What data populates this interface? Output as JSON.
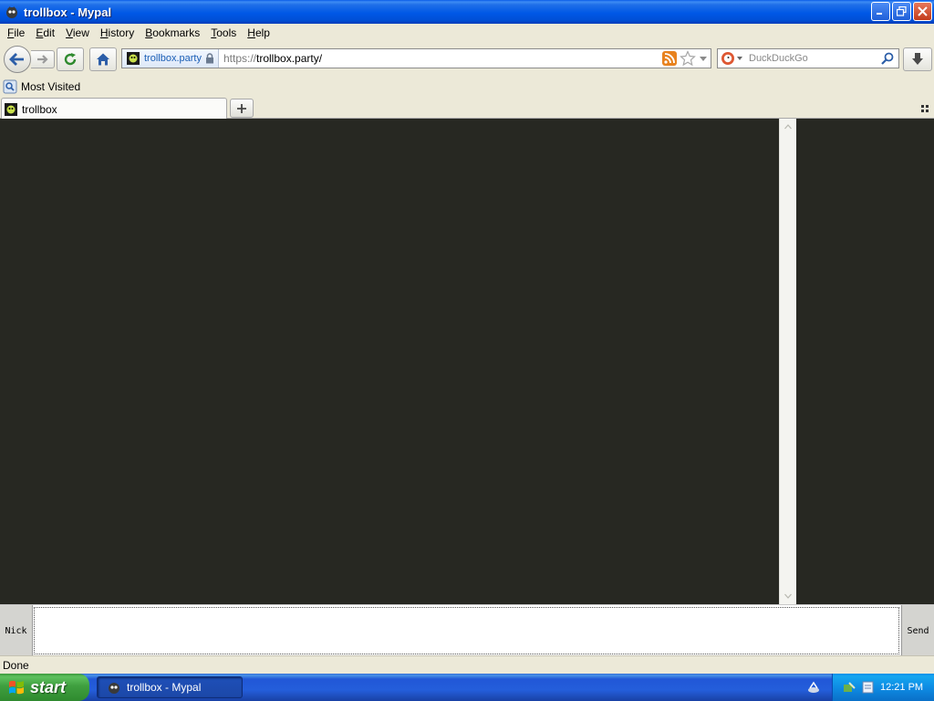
{
  "window": {
    "title": "trollbox - Mypal"
  },
  "menu": {
    "items": [
      {
        "accel": "F",
        "rest": "ile"
      },
      {
        "accel": "E",
        "rest": "dit"
      },
      {
        "accel": "V",
        "rest": "iew"
      },
      {
        "accel": "H",
        "rest": "istory"
      },
      {
        "accel": "B",
        "rest": "ookmarks"
      },
      {
        "accel": "T",
        "rest": "ools"
      },
      {
        "accel": "H",
        "rest": "elp"
      }
    ]
  },
  "navbar": {
    "site_identity": "trollbox.party",
    "url_scheme": "https://",
    "url_rest": "trollbox.party/",
    "search_placeholder": "DuckDuckGo"
  },
  "bookmarks": {
    "most_visited": "Most Visited"
  },
  "tabs": [
    {
      "label": "trollbox"
    }
  ],
  "chat": {
    "nick_label": "Nick",
    "send_label": "Send",
    "message_value": ""
  },
  "status": {
    "text": "Done"
  },
  "taskbar": {
    "start_label": "start",
    "task_label": "trollbox - Mypal",
    "clock": "12:21 PM"
  },
  "colors": {
    "chat_background": "#272822",
    "titlebar": "#0058e6",
    "chrome": "#ece9d8"
  }
}
